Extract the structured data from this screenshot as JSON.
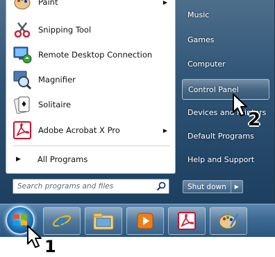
{
  "left_pane": {
    "programs": [
      {
        "label": "Paint",
        "icon": "paint-icon",
        "has_submenu": true
      },
      {
        "label": "Snipping Tool",
        "icon": "scissors-icon",
        "has_submenu": false
      },
      {
        "label": "Remote Desktop Connection",
        "icon": "remote-desktop-icon",
        "has_submenu": false
      },
      {
        "label": "Magnifier",
        "icon": "magnifier-icon",
        "has_submenu": false
      },
      {
        "label": "Solitaire",
        "icon": "solitaire-icon",
        "has_submenu": false
      },
      {
        "label": "Adobe Acrobat X Pro",
        "icon": "acrobat-icon",
        "has_submenu": true
      }
    ],
    "all_programs_label": "All Programs"
  },
  "search": {
    "placeholder": "Search programs and files"
  },
  "right_pane": {
    "items": [
      {
        "label": "Music"
      },
      {
        "label": "Games"
      },
      {
        "label": "Computer"
      },
      {
        "label": "Control Panel"
      },
      {
        "label": "Devices and Printers"
      },
      {
        "label": "Default Programs"
      },
      {
        "label": "Help and Support"
      }
    ],
    "highlighted_index": 3
  },
  "shutdown": {
    "label": "Shut down"
  },
  "taskbar": {
    "buttons": [
      {
        "name": "internet-explorer-icon"
      },
      {
        "name": "file-explorer-icon"
      },
      {
        "name": "media-player-icon"
      },
      {
        "name": "acrobat-icon"
      },
      {
        "name": "paint-icon"
      }
    ]
  },
  "steps": {
    "step1": "1",
    "step2": "2"
  },
  "colors": {
    "menu_dark": "#1d3f60",
    "menu_light": "#4e6f8c",
    "acrobat_red": "#c8102e",
    "taskbar": "#3d6a93"
  }
}
